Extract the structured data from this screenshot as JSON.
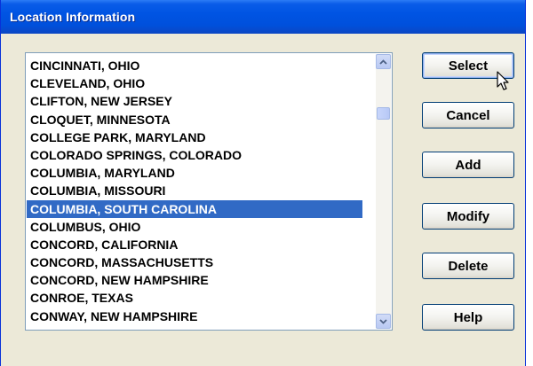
{
  "window": {
    "title": "Location Information"
  },
  "locations": [
    "CINCINNATI, OHIO",
    "CLEVELAND, OHIO",
    "CLIFTON, NEW JERSEY",
    "CLOQUET, MINNESOTA",
    "COLLEGE PARK, MARYLAND",
    "COLORADO SPRINGS, COLORADO",
    "COLUMBIA, MARYLAND",
    "COLUMBIA, MISSOURI",
    "COLUMBIA, SOUTH CAROLINA",
    "COLUMBUS, OHIO",
    "CONCORD, CALIFORNIA",
    "CONCORD, MASSACHUSETTS",
    "CONCORD, NEW HAMPSHIRE",
    "CONROE, TEXAS",
    "CONWAY, NEW HAMPSHIRE"
  ],
  "selected_location": "COLUMBIA, SOUTH CAROLINA",
  "buttons": {
    "select": "Select",
    "cancel": "Cancel",
    "add": "Add",
    "modify": "Modify",
    "delete": "Delete",
    "help": "Help"
  },
  "icons": {
    "scroll_up": "scroll-up-arrow-icon",
    "scroll_down": "scroll-down-arrow-icon",
    "cursor": "mouse-pointer-icon"
  },
  "colors": {
    "title_bar": "#0054e3",
    "selection": "#316ac5",
    "dialog_face": "#ece9d8"
  }
}
